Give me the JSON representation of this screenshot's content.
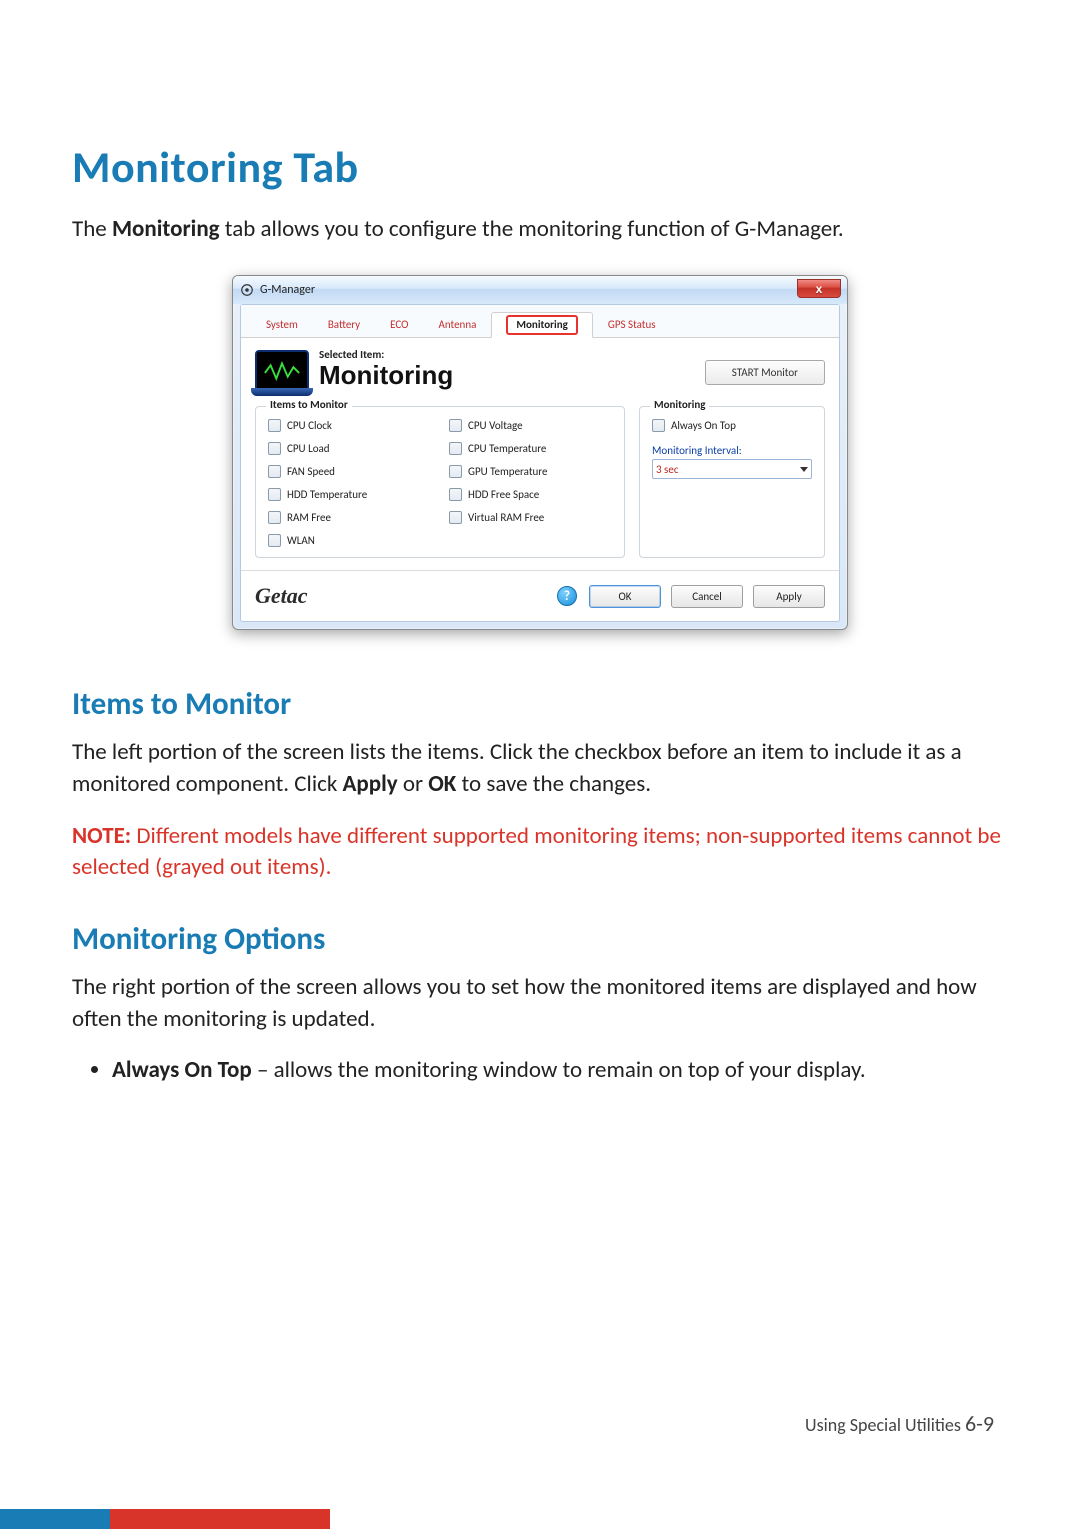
{
  "page": {
    "title": "Monitoring Tab",
    "intro_pre": "The ",
    "intro_bold": "Monitoring",
    "intro_post": " tab allows you to configure the monitoring function of G-Manager."
  },
  "window": {
    "title": "G-Manager",
    "close": "x",
    "tabs": {
      "system": "System",
      "battery": "Battery",
      "eco": "ECO",
      "antenna": "Antenna",
      "monitoring": "Monitoring",
      "gps": "GPS Status"
    },
    "header": {
      "selected_label": "Selected Item:",
      "monitoring_title": "Monitoring",
      "start_btn": "START Monitor"
    },
    "items_group": {
      "legend": "Items to Monitor",
      "cpu_clock": "CPU Clock",
      "cpu_voltage": "CPU Voltage",
      "cpu_load": "CPU Load",
      "cpu_temp": "CPU Temperature",
      "fan_speed": "FAN Speed",
      "gpu_temp": "GPU Temperature",
      "hdd_temp": "HDD Temperature",
      "hdd_free": "HDD Free Space",
      "ram_free": "RAM Free",
      "vram_free": "Virtual RAM Free",
      "wlan": "WLAN"
    },
    "monitoring_group": {
      "legend": "Monitoring",
      "always_on_top": "Always On Top",
      "interval_label": "Monitoring Interval:",
      "interval_value": "3 sec"
    },
    "footer": {
      "brand": "Getac",
      "help": "?",
      "ok": "OK",
      "cancel": "Cancel",
      "apply": "Apply"
    }
  },
  "section1": {
    "heading": "Items to Monitor",
    "body_pre": "The left portion of the screen lists the items. Click the checkbox before an item to include it as a monitored component. Click ",
    "body_b1": "Apply",
    "body_mid": " or ",
    "body_b2": "OK",
    "body_post": " to save the changes.",
    "note_bold": "NOTE:",
    "note_rest": " Different models have different supported monitoring items; non-supported items cannot be selected (grayed out items)."
  },
  "section2": {
    "heading": "Monitoring Options",
    "body": "The right portion of the screen allows you to set how the monitored items are displayed and how often the monitoring is updated.",
    "bullet_bold": "Always On Top",
    "bullet_rest": " – allows the monitoring window to remain on top of your display."
  },
  "footer": {
    "label": "Using Special Utilities   ",
    "pagenum": "6-9"
  }
}
